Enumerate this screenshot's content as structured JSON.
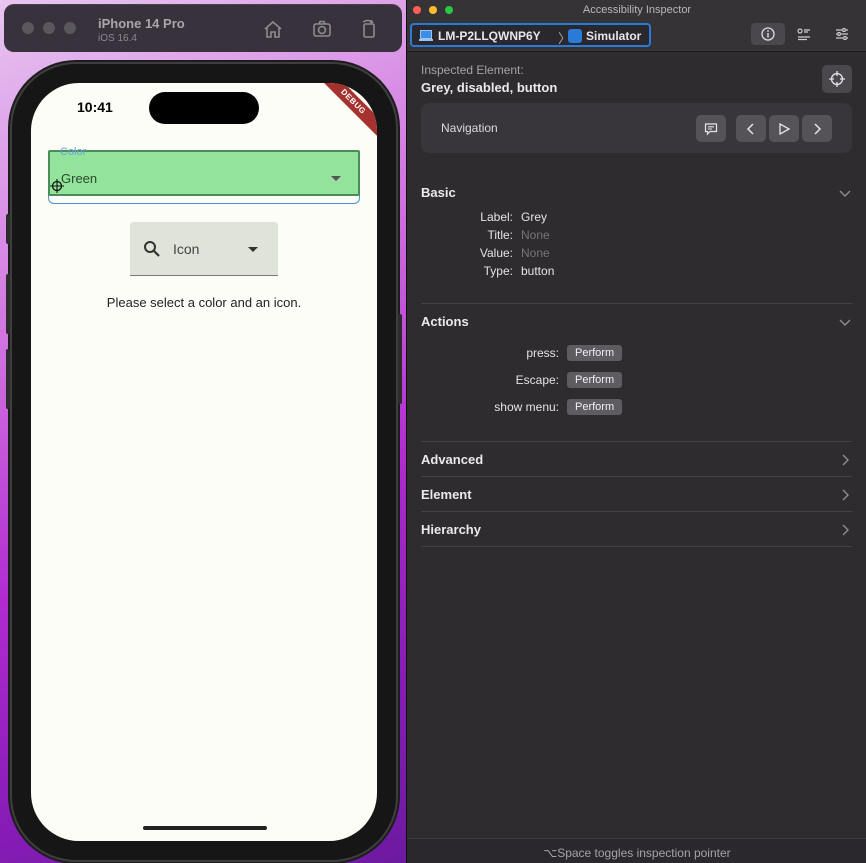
{
  "simulator": {
    "device_name": "iPhone 14 Pro",
    "os_version": "iOS 16.4",
    "status_time": "10:41",
    "debug_banner": "DEBUG",
    "app": {
      "color_field": {
        "label": "Color",
        "value": "Green"
      },
      "icon_dropdown": {
        "label": "Icon"
      },
      "hint": "Please select a color and an icon."
    }
  },
  "inspector": {
    "window_title": "Accessibility Inspector",
    "target": {
      "device": "LM-P2LLQWNP6Y",
      "app": "Simulator"
    },
    "inspected_label": "Inspected Element:",
    "inspected_value": "Grey, disabled, button",
    "navigation_label": "Navigation",
    "sections": {
      "basic": "Basic",
      "actions": "Actions",
      "advanced": "Advanced",
      "element": "Element",
      "hierarchy": "Hierarchy"
    },
    "basic": [
      {
        "key": "Label:",
        "value": "Grey",
        "muted": false
      },
      {
        "key": "Title:",
        "value": "None",
        "muted": true
      },
      {
        "key": "Value:",
        "value": "None",
        "muted": true
      },
      {
        "key": "Type:",
        "value": "button",
        "muted": false
      }
    ],
    "actions": [
      {
        "key": "press:",
        "button": "Perform"
      },
      {
        "key": "Escape:",
        "button": "Perform"
      },
      {
        "key": "show menu:",
        "button": "Perform"
      }
    ],
    "footer": "⌥Space toggles inspection pointer"
  },
  "colors": {
    "accent": "#2a7ad8",
    "highlight": "#78dc82",
    "traffic_close": "#ff5f57",
    "traffic_min": "#febc2e",
    "traffic_max": "#28c840"
  }
}
